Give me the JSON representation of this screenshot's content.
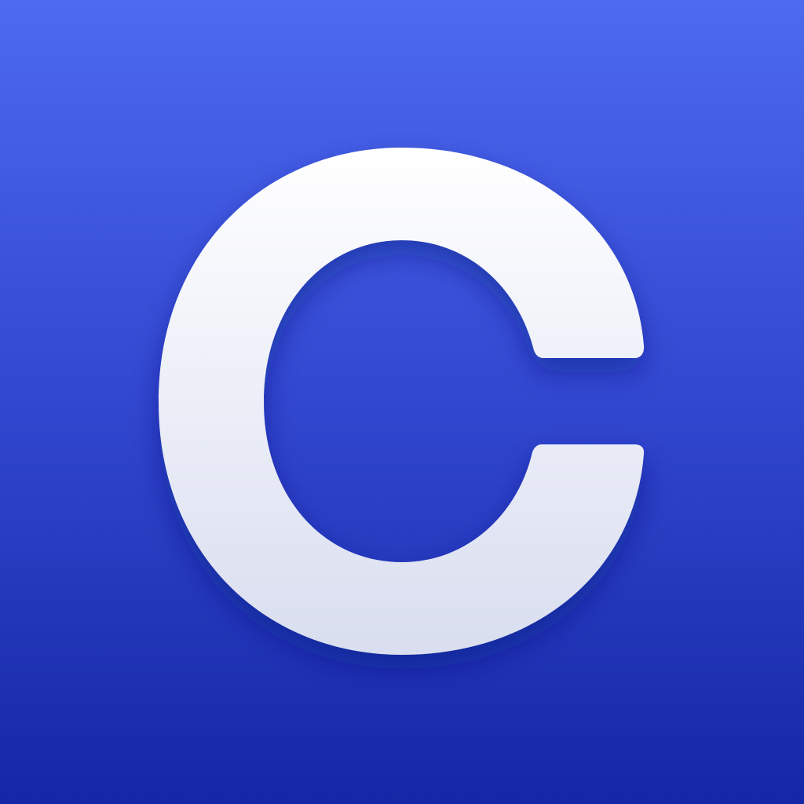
{
  "app_icon": {
    "logo_letter": "C",
    "colors": {
      "background_top": "#4d6af0",
      "background_mid": "#3147cf",
      "background_bottom": "#1527a6",
      "glyph_top": "#ffffff",
      "glyph_bottom": "#d9def0",
      "glyph_shadow": "#0c1a78"
    }
  }
}
